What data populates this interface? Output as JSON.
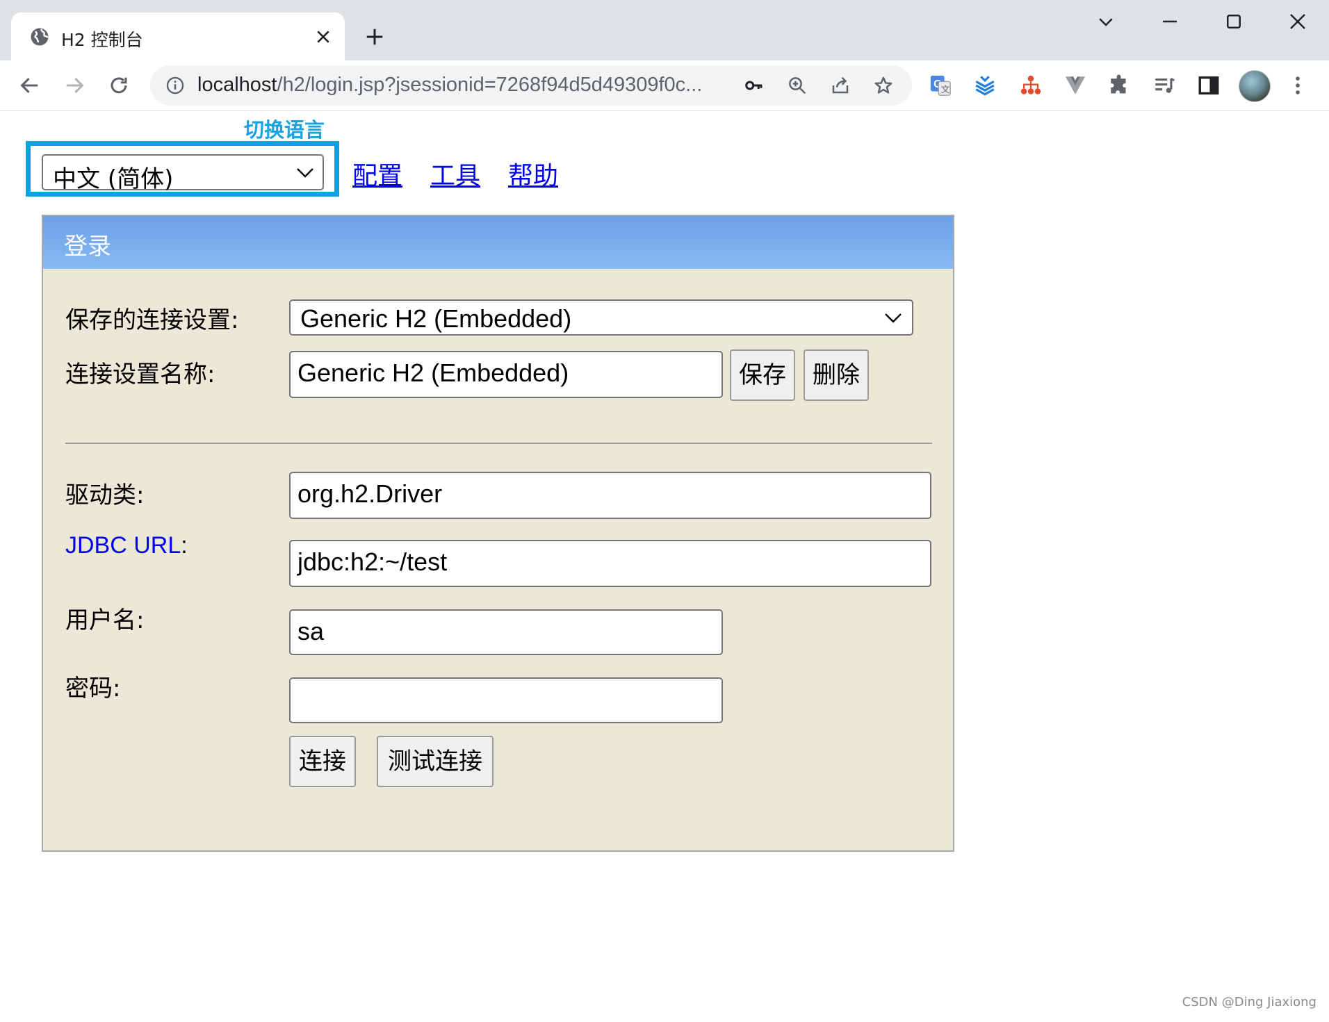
{
  "browser": {
    "tab": {
      "title": "H2 控制台",
      "favicon": "globe-icon"
    },
    "url_host": "localhost",
    "url_rest": "/h2/login.jsp?jsessionid=7268f94d5d49309f0c...",
    "toolbar_icons": [
      "back-icon",
      "forward-icon",
      "reload-icon",
      "info-icon",
      "key-icon",
      "zoom-icon",
      "share-icon",
      "star-icon"
    ],
    "extension_icons": [
      "google-translate-icon",
      "extension-stack-icon",
      "extension-tree-icon",
      "vue-devtools-icon",
      "puzzle-icon",
      "reading-list-icon",
      "side-panel-icon",
      "more-vert-icon"
    ]
  },
  "annotation": {
    "label": "切换语言",
    "color": "#0aa2e1"
  },
  "language_select": {
    "value": "中文 (简体)"
  },
  "nav_links": {
    "settings": "配置",
    "tools": "工具",
    "help": "帮助"
  },
  "login": {
    "title": "登录",
    "saved_settings_label": "保存的连接设置:",
    "saved_settings_value": "Generic H2 (Embedded)",
    "setting_name_label": "连接设置名称:",
    "setting_name_value": "Generic H2 (Embedded)",
    "save_button": "保存",
    "delete_button": "删除",
    "driver_label": "驱动类:",
    "driver_value": "org.h2.Driver",
    "jdbc_label_link": "JDBC URL",
    "jdbc_label_suffix": ":",
    "jdbc_value": "jdbc:h2:~/test",
    "user_label": "用户名:",
    "user_value": "sa",
    "password_label": "密码:",
    "password_value": "",
    "connect_button": "连接",
    "test_button": "测试连接"
  },
  "colors": {
    "header_blue": "#7aaeee",
    "panel_bg": "#ece8d8",
    "link": "#0000ee"
  },
  "watermark": "CSDN @Ding Jiaxiong"
}
